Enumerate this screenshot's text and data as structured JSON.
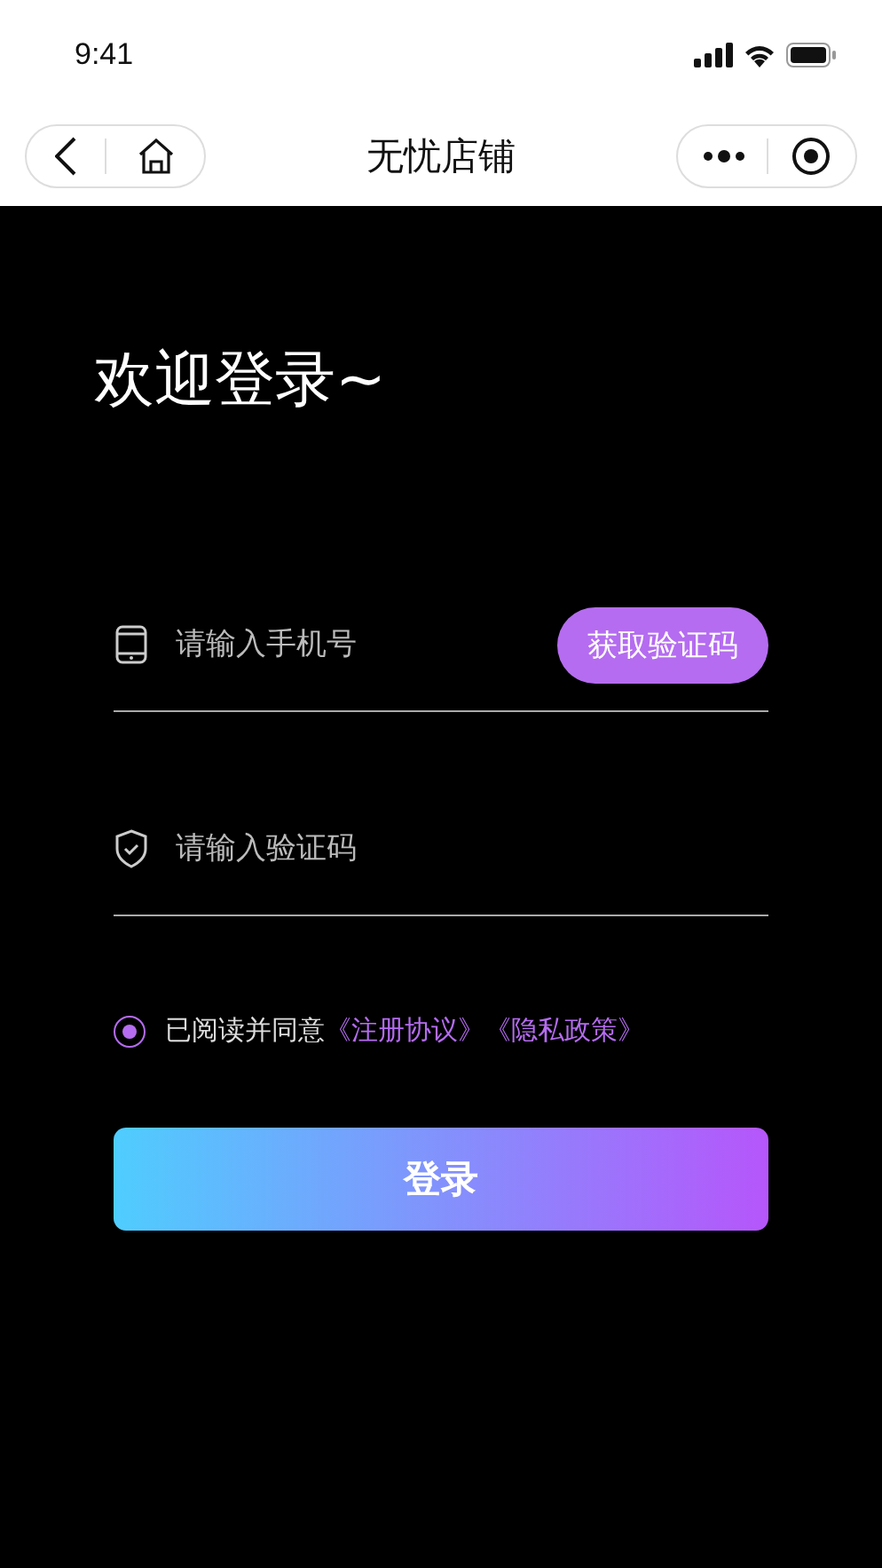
{
  "status_bar": {
    "time": "9:41"
  },
  "nav_bar": {
    "title": "无忧店铺"
  },
  "heading": "欢迎登录~",
  "phone_field": {
    "placeholder": "请输入手机号"
  },
  "code_button": "获取验证码",
  "code_field": {
    "placeholder": "请输入验证码"
  },
  "agreement": {
    "checked": true,
    "text": "已阅读并同意",
    "links": [
      "《注册协议》",
      "《隐私政策》"
    ]
  },
  "login_button": "登录"
}
